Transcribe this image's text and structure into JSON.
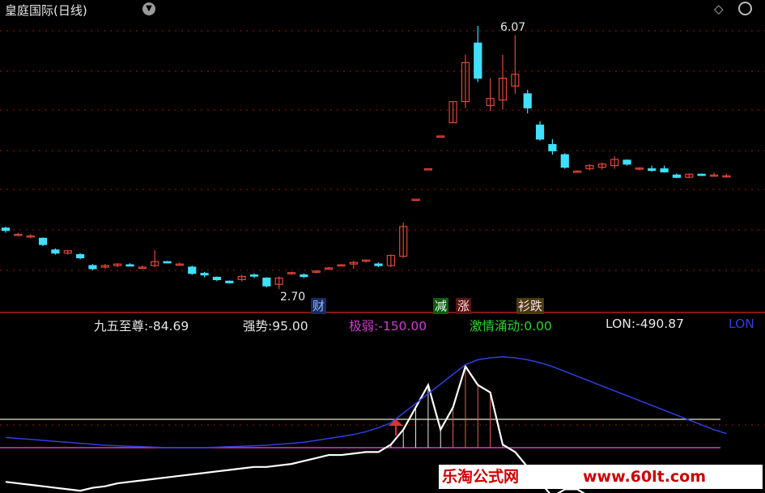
{
  "window": {
    "title": "皇庭国际(日线)"
  },
  "price_labels": {
    "high": "6.07",
    "low": "2.70"
  },
  "signals": {
    "cai": "财",
    "jian": "减",
    "zhang": "涨",
    "shuai": "衫跌"
  },
  "indicators": [
    {
      "label": "九五至尊:",
      "value": "-84.69",
      "color": "#e6e6e6"
    },
    {
      "label": "强势:",
      "value": "95.00",
      "color": "#e6e6e6"
    },
    {
      "label": "极弱:",
      "value": "-150.00",
      "color": "#d23cd2"
    },
    {
      "label": "激情涌动:",
      "value": "0.00",
      "color": "#2fd12f"
    },
    {
      "label": "LON:",
      "value": "-490.87",
      "color": "#e6e6e6"
    },
    {
      "label": "LON",
      "value": "",
      "color": "#2f3fe0"
    }
  ],
  "watermark": {
    "text": "乐淘公式网",
    "url": "www.60lt.com"
  },
  "colors": {
    "up": "#e0463c",
    "down": "#40e0ff",
    "grid": "#a01414",
    "bg": "#000000"
  },
  "chart_data": [
    {
      "type": "candlestick",
      "title": "皇庭国际(日线)",
      "series": [
        {
          "values": [
            [
              3.48,
              3.5,
              3.42,
              3.45
            ],
            [
              3.4,
              3.42,
              3.38,
              3.4
            ],
            [
              3.38,
              3.4,
              3.35,
              3.38
            ],
            [
              3.35,
              3.36,
              3.25,
              3.27
            ],
            [
              3.2,
              3.22,
              3.14,
              3.16
            ],
            [
              3.16,
              3.2,
              3.14,
              3.19
            ],
            [
              3.14,
              3.16,
              3.08,
              3.1
            ],
            [
              3.0,
              3.02,
              2.94,
              2.96
            ],
            [
              2.98,
              3.02,
              2.96,
              3.0
            ],
            [
              3.0,
              3.03,
              2.98,
              3.02
            ],
            [
              3.01,
              3.03,
              2.99,
              3.0
            ],
            [
              2.98,
              3.0,
              2.96,
              2.98
            ],
            [
              3.0,
              3.2,
              2.98,
              3.05
            ],
            [
              3.05,
              3.06,
              3.03,
              3.04
            ],
            [
              3.02,
              3.04,
              3.0,
              3.02
            ],
            [
              2.98,
              3.0,
              2.88,
              2.9
            ],
            [
              2.9,
              2.92,
              2.85,
              2.88
            ],
            [
              2.85,
              2.86,
              2.8,
              2.82
            ],
            [
              2.8,
              2.81,
              2.77,
              2.78
            ],
            [
              2.82,
              2.88,
              2.8,
              2.86
            ],
            [
              2.88,
              2.9,
              2.84,
              2.87
            ],
            [
              2.84,
              2.85,
              2.72,
              2.74
            ],
            [
              2.76,
              2.86,
              2.7,
              2.84
            ],
            [
              2.9,
              2.92,
              2.88,
              2.91
            ],
            [
              2.88,
              2.9,
              2.84,
              2.86
            ],
            [
              2.92,
              2.94,
              2.9,
              2.93
            ],
            [
              2.96,
              2.98,
              2.95,
              2.97
            ],
            [
              3.0,
              3.02,
              2.99,
              3.01
            ],
            [
              3.02,
              3.06,
              2.96,
              3.04
            ],
            [
              3.06,
              3.08,
              3.04,
              3.07
            ],
            [
              3.02,
              3.04,
              2.98,
              3.0
            ],
            [
              3.0,
              3.14,
              2.98,
              3.13
            ],
            [
              3.12,
              3.55,
              3.1,
              3.5
            ],
            [
              3.85,
              3.85,
              3.85,
              3.85
            ],
            [
              4.24,
              4.24,
              4.24,
              4.24
            ],
            [
              4.66,
              4.66,
              4.66,
              4.66
            ],
            [
              4.83,
              5.1,
              4.83,
              5.1
            ],
            [
              5.1,
              5.7,
              5.02,
              5.6
            ],
            [
              5.85,
              6.07,
              5.35,
              5.4
            ],
            [
              5.05,
              5.4,
              4.98,
              5.14
            ],
            [
              5.12,
              5.7,
              5.0,
              5.4
            ],
            [
              5.3,
              5.95,
              5.2,
              5.45
            ],
            [
              5.2,
              5.25,
              4.95,
              5.02
            ],
            [
              4.8,
              4.85,
              4.6,
              4.62
            ],
            [
              4.55,
              4.62,
              4.42,
              4.47
            ],
            [
              4.42,
              4.44,
              4.24,
              4.26
            ],
            [
              4.2,
              4.22,
              4.2,
              4.21
            ],
            [
              4.24,
              4.3,
              4.22,
              4.28
            ],
            [
              4.26,
              4.32,
              4.23,
              4.3
            ],
            [
              4.28,
              4.4,
              4.24,
              4.36
            ],
            [
              4.35,
              4.36,
              4.28,
              4.3
            ],
            [
              4.24,
              4.26,
              4.22,
              4.25
            ],
            [
              4.24,
              4.28,
              4.2,
              4.22
            ],
            [
              4.24,
              4.28,
              4.19,
              4.2
            ],
            [
              4.16,
              4.18,
              4.12,
              4.13
            ],
            [
              4.13,
              4.18,
              4.12,
              4.17
            ],
            [
              4.17,
              4.18,
              4.15,
              4.16
            ],
            [
              4.16,
              4.19,
              4.14,
              4.16
            ],
            [
              4.15,
              4.18,
              4.13,
              4.15
            ]
          ]
        }
      ]
    },
    {
      "type": "line",
      "series": [
        {
          "name": "九五至尊",
          "color": "#ffffff",
          "values": [
            -60,
            -62,
            -64,
            -66,
            -68,
            -70,
            -72,
            -68,
            -66,
            -62,
            -60,
            -58,
            -56,
            -54,
            -52,
            -50,
            -48,
            -46,
            -44,
            -42,
            -40,
            -40,
            -38,
            -36,
            -32,
            -28,
            -24,
            -24,
            -22,
            -20,
            -20,
            -10,
            10,
            40,
            70,
            10,
            40,
            95,
            70,
            60,
            -10,
            -20,
            -40,
            -60,
            -80,
            -70,
            -70,
            -80,
            -85,
            -80,
            -85,
            -82,
            -84,
            -84,
            -85,
            -80,
            -84,
            -85,
            -85
          ]
        },
        {
          "name": "LON",
          "color": "#2f3fe0",
          "values": [
            -400,
            -410,
            -420,
            -430,
            -440,
            -450,
            -460,
            -470,
            -480,
            -485,
            -490,
            -495,
            -500,
            -505,
            -505,
            -505,
            -505,
            -500,
            -495,
            -490,
            -485,
            -480,
            -470,
            -460,
            -450,
            -430,
            -410,
            -390,
            -370,
            -340,
            -300,
            -250,
            -150,
            -50,
            50,
            150,
            250,
            350,
            400,
            420,
            430,
            420,
            400,
            370,
            330,
            280,
            230,
            180,
            130,
            80,
            30,
            -20,
            -70,
            -120,
            -170,
            -220,
            -270,
            -320,
            -360
          ]
        }
      ],
      "levels": {
        "强势": 95.0,
        "极弱": -150.0
      }
    }
  ]
}
